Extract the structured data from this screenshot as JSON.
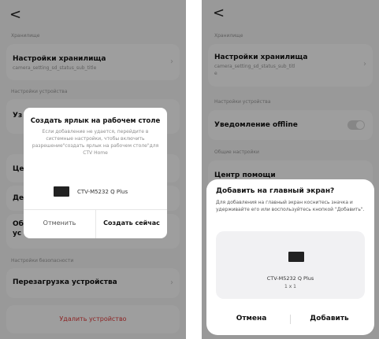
{
  "left": {
    "back": "<",
    "storage_section": "Хранилище",
    "storage_title": "Настройки хранилища",
    "storage_sub": "camera_setting_sd_status_sub_title",
    "device_settings_section": "Настройки устройства",
    "partial_1": "Уз",
    "partial_2": "Це",
    "partial_3": "Де",
    "partial_4": "Об",
    "partial_5": "ус",
    "security_section": "Настройки безопасности",
    "restart": "Перезагрузка устройства",
    "delete": "Удалить устройство",
    "dialog": {
      "title": "Создать ярлык на рабочем столе",
      "body": "Если добавление не удается, перейдите в системные настройки, чтобы включить разрешение\"создать ярлык на рабочем столе\"для CTV Home",
      "device": "CTV-M5232 Q Plus",
      "cancel": "Отменить",
      "confirm": "Создать сейчас"
    }
  },
  "right": {
    "back": "<",
    "storage_section": "Хранилище",
    "storage_title": "Настройки хранилища",
    "storage_sub": "camera_setting_sd_status_sub_titl",
    "storage_sub2": "e",
    "device_settings_section": "Настройки устройства",
    "offline_label": "Уведомление offline",
    "general_section": "Общие настройки",
    "help_center": "Центр помощи",
    "dialog": {
      "title": "Добавить на главный экран?",
      "body": "Для добавления на главный экран коснитесь значка и удерживайте его или воспользуйтесь кнопкой \"Добавить\".",
      "device": "CTV-M5232 Q Plus",
      "size": "1 x 1",
      "cancel": "Отмена",
      "confirm": "Добавить"
    }
  }
}
